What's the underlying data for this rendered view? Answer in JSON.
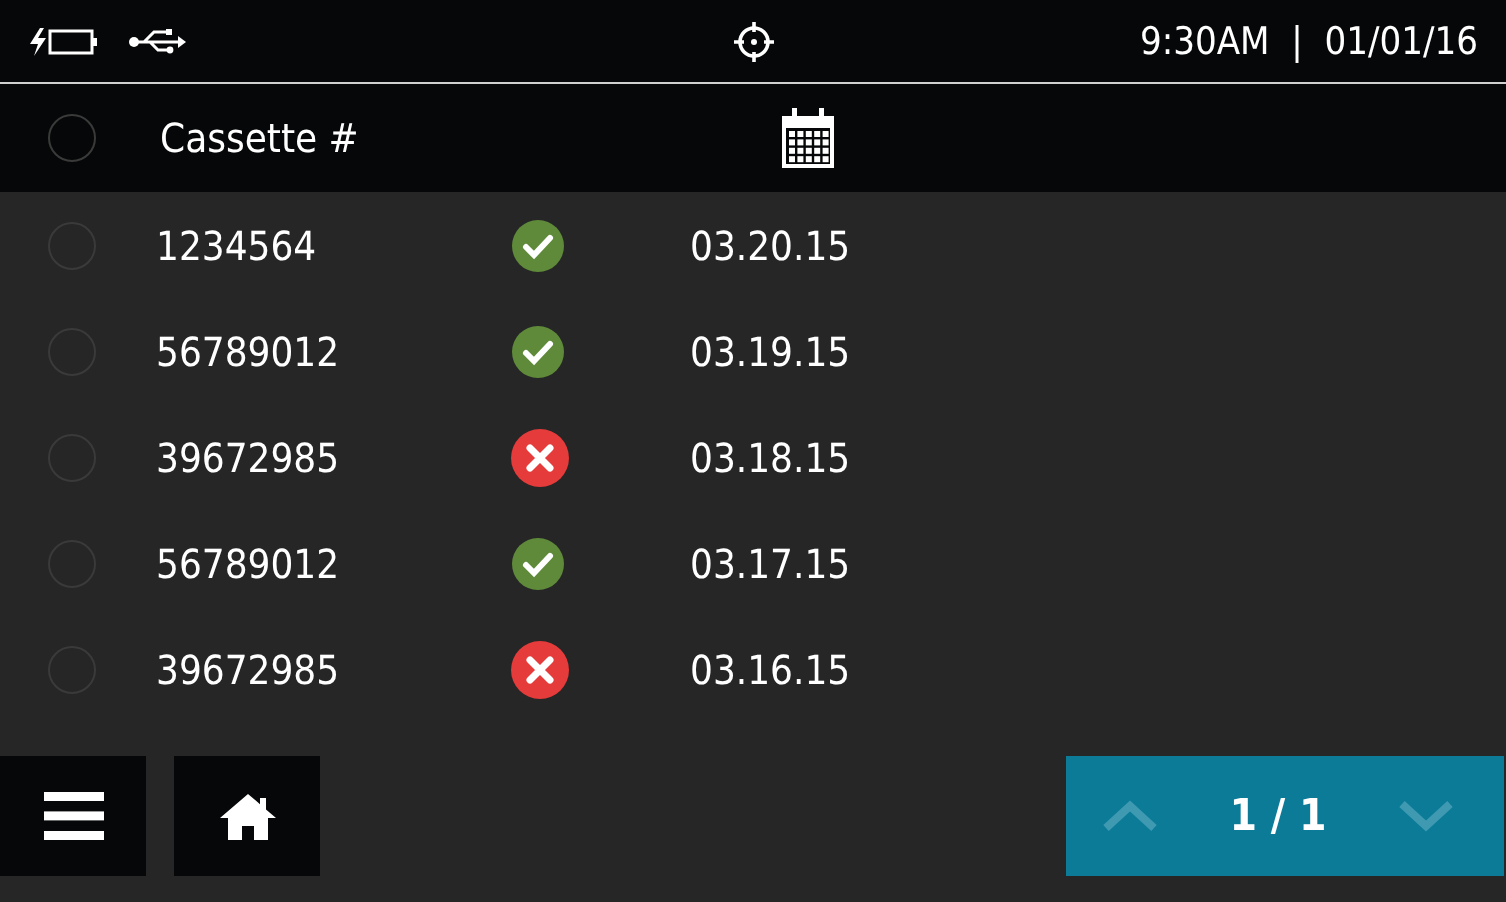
{
  "status_bar": {
    "clock": "9:30AM  |  01/01/16"
  },
  "table": {
    "header": {
      "selected": false,
      "cassette_label": "Cassette #"
    },
    "rows": [
      {
        "selected": false,
        "cassette": "1234564",
        "kind": "pass",
        "date": "03.20.15"
      },
      {
        "selected": false,
        "cassette": "56789012",
        "kind": "pass",
        "date": "03.19.15"
      },
      {
        "selected": false,
        "cassette": "39672985",
        "kind": "fail",
        "date": "03.18.15"
      },
      {
        "selected": false,
        "cassette": "56789012",
        "kind": "pass",
        "date": "03.17.15"
      },
      {
        "selected": false,
        "cassette": "39672985",
        "kind": "fail",
        "date": "03.16.15"
      }
    ]
  },
  "pager": {
    "page": "1 / 1",
    "up_disabled": true,
    "down_disabled": true
  }
}
